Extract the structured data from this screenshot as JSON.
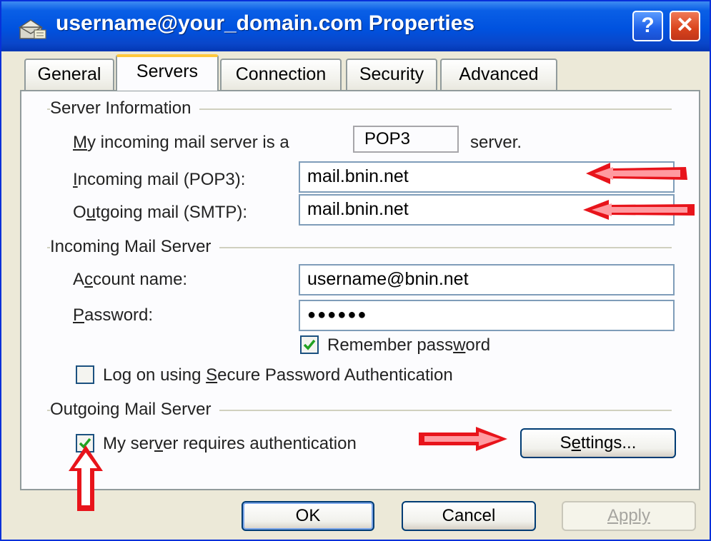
{
  "window": {
    "title": "username@your_domain.com Properties",
    "help_glyph": "?",
    "close_glyph": "✕",
    "title_icon": "mail-account-icon"
  },
  "tabs": [
    {
      "label": "General",
      "active": false
    },
    {
      "label": "Servers",
      "active": true
    },
    {
      "label": "Connection",
      "active": false
    },
    {
      "label": "Security",
      "active": false
    },
    {
      "label": "Advanced",
      "active": false
    }
  ],
  "server_info": {
    "group_label": "Server Information",
    "incoming_type_prefix": "y incoming mail server is a",
    "incoming_type_accel": "M",
    "incoming_type_value": "POP3",
    "incoming_type_suffix": "server.",
    "incoming_label_accel": "I",
    "incoming_label_rest": "ncoming mail (POP3):",
    "incoming_value": "mail.bnin.net",
    "outgoing_label_pre": "O",
    "outgoing_label_accel": "u",
    "outgoing_label_rest": "tgoing mail (SMTP):",
    "outgoing_value": "mail.bnin.net"
  },
  "incoming_server": {
    "group_label": "Incoming Mail Server",
    "account_label_pre": "A",
    "account_label_accel": "c",
    "account_label_rest": "count name:",
    "account_value": "username@bnin.net",
    "password_label_accel": "P",
    "password_label_rest": "assword:",
    "password_value": "●●●●●●",
    "remember_pre": "Remember pass",
    "remember_accel": "w",
    "remember_rest": "ord",
    "remember_checked": true,
    "spa_pre": "Log on using ",
    "spa_accel": "S",
    "spa_rest": "ecure Password Authentication",
    "spa_checked": false
  },
  "outgoing_server": {
    "group_label": "Outgoing Mail Server",
    "auth_pre": "My ser",
    "auth_accel": "v",
    "auth_rest": "er requires authentication",
    "auth_checked": true,
    "settings_pre": "S",
    "settings_accel": "e",
    "settings_rest": "ttings..."
  },
  "footer": {
    "ok": "OK",
    "cancel": "Cancel",
    "apply": "Apply"
  },
  "annotations": {
    "arrow_color": "#e8141b"
  }
}
